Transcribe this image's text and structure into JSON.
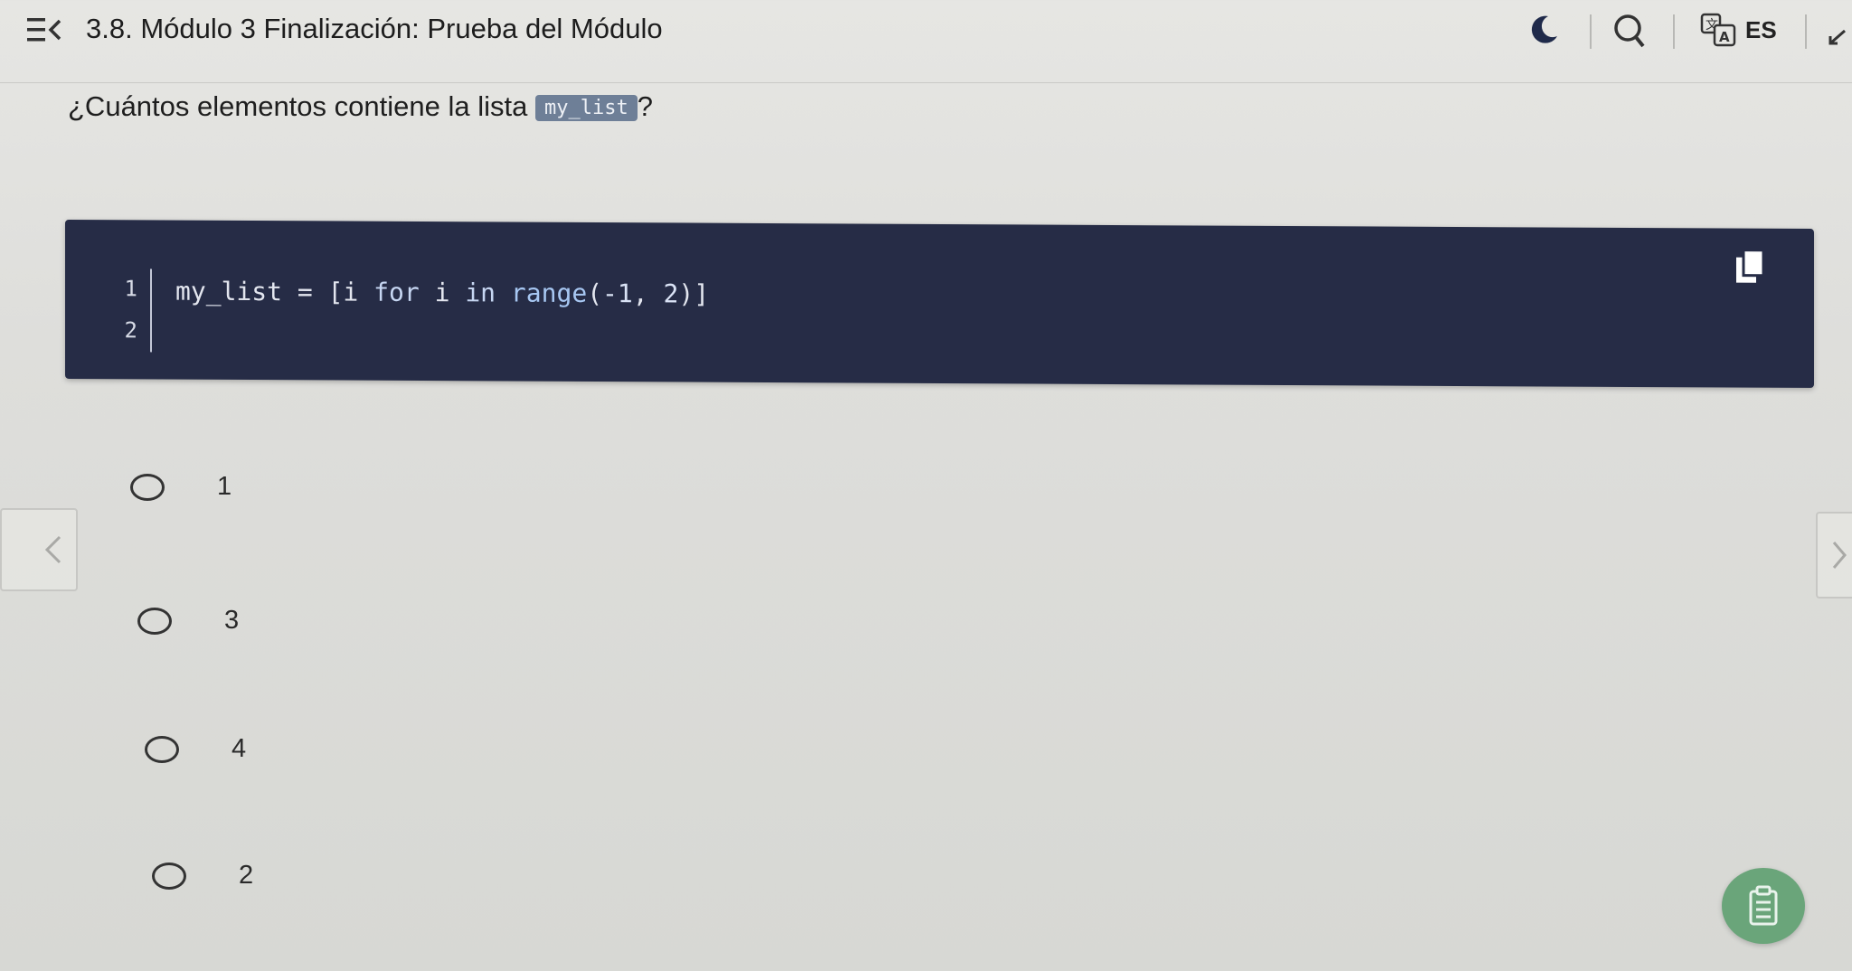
{
  "header": {
    "title": "3.8. Módulo 3 Finalización: Prueba del Módulo",
    "language": "ES",
    "icons": [
      "menu-collapse-icon",
      "moon-icon",
      "search-icon",
      "translate-icon",
      "user-icon"
    ]
  },
  "question": {
    "text_before": "¿Cuántos elementos contiene la lista",
    "code": "my_list",
    "text_after": "?"
  },
  "code_block": {
    "line_numbers": [
      "1",
      "2"
    ],
    "code": {
      "part1": "my_list = [i ",
      "kw_for": "for",
      "part2": " i ",
      "kw_in": "in",
      "part3": " ",
      "fn_range": "range",
      "part4": "(",
      "arg1": "-1",
      "part5": ", ",
      "arg2": "2",
      "part6": ")]"
    },
    "copy_icon": "copy-icon"
  },
  "options": [
    {
      "label": "1"
    },
    {
      "label": "3"
    },
    {
      "label": "4"
    },
    {
      "label": "2"
    }
  ],
  "nav": {
    "prev_icon": "chevron-left-icon",
    "next_icon": "chevron-right-icon"
  },
  "notes_button": {
    "icon": "notes-icon",
    "color": "#6aa57a"
  },
  "colors": {
    "code_background": "#262c46",
    "inline_code_background": "#6e7f97"
  }
}
